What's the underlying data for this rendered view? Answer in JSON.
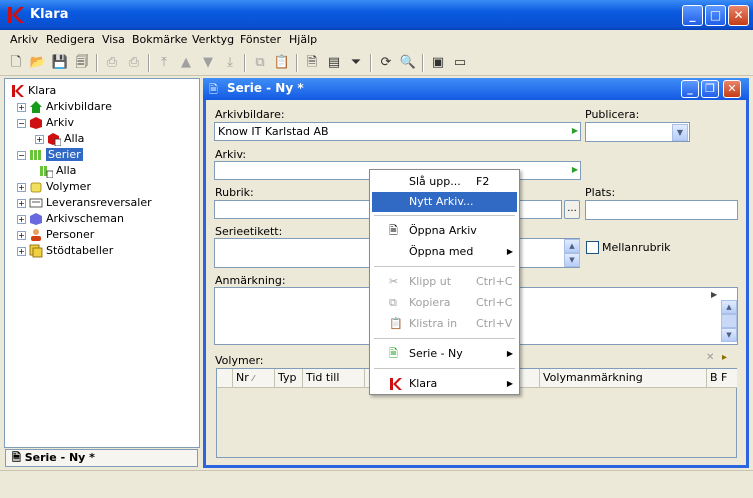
{
  "app": {
    "title": "Klara"
  },
  "menu": [
    "Arkiv",
    "Redigera",
    "Visa",
    "Bokmärke",
    "Verktyg",
    "Fönster",
    "Hjälp"
  ],
  "tree": {
    "root": "Klara",
    "items": [
      {
        "label": "Arkivbildare"
      },
      {
        "label": "Arkiv"
      },
      {
        "label": "Alla"
      },
      {
        "label": "Serier"
      },
      {
        "label": "Alla"
      },
      {
        "label": "Volymer"
      },
      {
        "label": "Leveransreversaler"
      },
      {
        "label": "Arkivscheman"
      },
      {
        "label": "Personer"
      },
      {
        "label": "Stödtabeller"
      }
    ]
  },
  "taskbar": {
    "label": "Serie - Ny *"
  },
  "child": {
    "title": "Serie - Ny *"
  },
  "form": {
    "arkivbildare_label": "Arkivbildare:",
    "arkivbildare_value": "Know IT Karlstad AB",
    "publicera_label": "Publicera:",
    "arkiv_label": "Arkiv:",
    "rubrik_label": "Rubrik:",
    "plats_label": "Plats:",
    "ellipsis": "...",
    "serieetikett_label": "Serieetikett:",
    "mellanrubrik_label": "Mellanrubrik",
    "anmarkning_label": "Anmärkning:",
    "volymer_label": "Volymer:"
  },
  "grid": {
    "headers": [
      "Nr",
      "Typ",
      "Tid till",
      "Volymanmärkning",
      "B F"
    ]
  },
  "context_menu": {
    "items": [
      {
        "label": "Slå upp...",
        "shortcut": "F2"
      },
      {
        "label": "Nytt Arkiv..."
      },
      {
        "label": "Öppna Arkiv"
      },
      {
        "label": "Öppna med"
      },
      {
        "label": "Klipp ut",
        "shortcut": "Ctrl+C"
      },
      {
        "label": "Kopiera",
        "shortcut": "Ctrl+C"
      },
      {
        "label": "Klistra in",
        "shortcut": "Ctrl+V"
      },
      {
        "label": "Serie - Ny"
      },
      {
        "label": "Klara"
      }
    ]
  },
  "colors": {
    "titlebar": "#0a5ae0",
    "selection": "#316ac5",
    "brand_red": "#d01010"
  }
}
